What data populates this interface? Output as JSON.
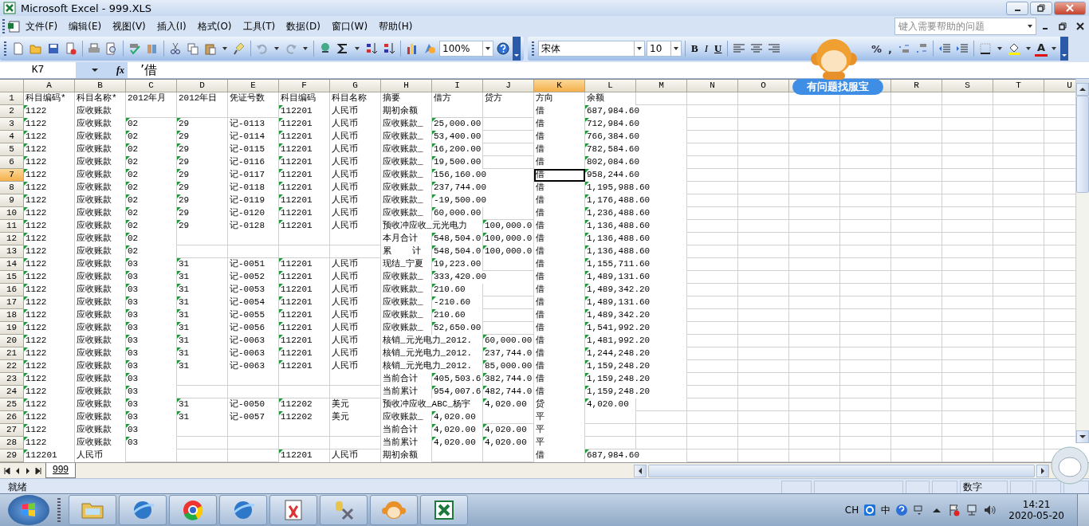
{
  "window": {
    "title": "Microsoft Excel - 999.XLS"
  },
  "menu": [
    "文件(F)",
    "编辑(E)",
    "视图(V)",
    "插入(I)",
    "格式(O)",
    "工具(T)",
    "数据(D)",
    "窗口(W)",
    "帮助(H)"
  ],
  "help_search": {
    "placeholder": "键入需要帮助的问题"
  },
  "standard_toolbar": {
    "zoom": "100%"
  },
  "formatting_toolbar": {
    "font": "宋体",
    "size": "10",
    "bold": "B",
    "italic": "I",
    "underline": "U",
    "percent": "%",
    "comma": ",",
    "font_color": "A"
  },
  "formula_bar": {
    "name_box": "K7",
    "function_label": "fx",
    "formula": "’借"
  },
  "columns": [
    {
      "label": "A",
      "selected": false,
      "text_numbers": true
    },
    {
      "label": "B",
      "selected": false
    },
    {
      "label": "C",
      "selected": false,
      "text_numbers": true
    },
    {
      "label": "D",
      "selected": false,
      "text_numbers": true
    },
    {
      "label": "E",
      "selected": false
    },
    {
      "label": "F",
      "selected": false,
      "text_numbers": true
    },
    {
      "label": "G",
      "selected": false
    },
    {
      "label": "H",
      "selected": false
    },
    {
      "label": "I",
      "selected": false,
      "text_numbers": true
    },
    {
      "label": "J",
      "selected": false,
      "text_numbers": true
    },
    {
      "label": "K",
      "selected": true
    },
    {
      "label": "L",
      "selected": false,
      "text_numbers": true
    },
    {
      "label": "M",
      "selected": false
    },
    {
      "label": "N",
      "selected": false
    },
    {
      "label": "O",
      "selected": false
    },
    {
      "selected": false
    },
    {
      "selected": false
    },
    {
      "label": "R",
      "selected": false
    },
    {
      "label": "S",
      "selected": false
    },
    {
      "label": "T",
      "selected": false
    },
    {
      "label": "U",
      "selected": false
    }
  ],
  "rows": [
    {
      "label": "1",
      "selected": false,
      "cells": [
        "科目编码*",
        "科目名称*",
        "2012年月",
        "2012年日",
        "凭证号数",
        "科目编码",
        "科目名称",
        "摘要",
        "借方",
        "贷方",
        "方向",
        "余额"
      ]
    },
    {
      "label": "2",
      "selected": false,
      "cells": [
        "1122",
        "应收账款",
        "",
        "",
        "",
        "112201",
        "人民币",
        "期初余额",
        "",
        "",
        "借",
        "687,984.60"
      ]
    },
    {
      "label": "3",
      "selected": false,
      "cells": [
        "1122",
        "应收账款",
        "02",
        "29",
        "记-0113",
        "112201",
        "人民币",
        "应收账款_",
        "25,000.00",
        "",
        "借",
        "712,984.60"
      ]
    },
    {
      "label": "4",
      "selected": false,
      "cells": [
        "1122",
        "应收账款",
        "02",
        "29",
        "记-0114",
        "112201",
        "人民币",
        "应收账款_",
        "53,400.00",
        "",
        "借",
        "766,384.60"
      ]
    },
    {
      "label": "5",
      "selected": false,
      "cells": [
        "1122",
        "应收账款",
        "02",
        "29",
        "记-0115",
        "112201",
        "人民币",
        "应收账款_",
        "16,200.00",
        "",
        "借",
        "782,584.60"
      ]
    },
    {
      "label": "6",
      "selected": false,
      "cells": [
        "1122",
        "应收账款",
        "02",
        "29",
        "记-0116",
        "112201",
        "人民币",
        "应收账款_",
        "19,500.00",
        "",
        "借",
        "802,084.60"
      ]
    },
    {
      "label": "7",
      "selected": true,
      "cells": [
        "1122",
        "应收账款",
        "02",
        "29",
        "记-0117",
        "112201",
        "人民币",
        "应收账款_",
        "156,160.00",
        "",
        "借",
        "958,244.60"
      ]
    },
    {
      "label": "8",
      "selected": false,
      "cells": [
        "1122",
        "应收账款",
        "02",
        "29",
        "记-0118",
        "112201",
        "人民币",
        "应收账款_",
        "237,744.00",
        "",
        "借",
        "1,195,988.60"
      ]
    },
    {
      "label": "9",
      "selected": false,
      "cells": [
        "1122",
        "应收账款",
        "02",
        "29",
        "记-0119",
        "112201",
        "人民币",
        "应收账款_",
        "-19,500.00",
        "",
        "借",
        "1,176,488.60"
      ]
    },
    {
      "label": "10",
      "selected": false,
      "cells": [
        "1122",
        "应收账款",
        "02",
        "29",
        "记-0120",
        "112201",
        "人民币",
        "应收账款_",
        "60,000.00",
        "",
        "借",
        "1,236,488.60"
      ]
    },
    {
      "label": "11",
      "selected": false,
      "cells": [
        "1122",
        "应收账款",
        "02",
        "29",
        "记-0128",
        "112201",
        "人民币",
        "预收冲应收_元光电力",
        "",
        "100,000.0",
        "借",
        "1,136,488.60"
      ]
    },
    {
      "label": "12",
      "selected": false,
      "cells": [
        "1122",
        "应收账款",
        "02",
        "",
        "",
        "",
        "",
        "本月合计",
        "548,504.0",
        "100,000.0",
        "借",
        "1,136,488.60"
      ]
    },
    {
      "label": "13",
      "selected": false,
      "cells": [
        "1122",
        "应收账款",
        "02",
        "",
        "",
        "",
        "",
        "累    计",
        "548,504.0",
        "100,000.0",
        "借",
        "1,136,488.60"
      ]
    },
    {
      "label": "14",
      "selected": false,
      "cells": [
        "1122",
        "应收账款",
        "03",
        "31",
        "记-0051",
        "112201",
        "人民币",
        "现结_宁夏",
        "19,223.00",
        "",
        "借",
        "1,155,711.60"
      ]
    },
    {
      "label": "15",
      "selected": false,
      "cells": [
        "1122",
        "应收账款",
        "03",
        "31",
        "记-0052",
        "112201",
        "人民币",
        "应收账款_",
        "333,420.00",
        "",
        "借",
        "1,489,131.60"
      ]
    },
    {
      "label": "16",
      "selected": false,
      "cells": [
        "1122",
        "应收账款",
        "03",
        "31",
        "记-0053",
        "112201",
        "人民币",
        "应收账款_",
        "210.60",
        "",
        "借",
        "1,489,342.20"
      ]
    },
    {
      "label": "17",
      "selected": false,
      "cells": [
        "1122",
        "应收账款",
        "03",
        "31",
        "记-0054",
        "112201",
        "人民币",
        "应收账款_",
        "-210.60",
        "",
        "借",
        "1,489,131.60"
      ]
    },
    {
      "label": "18",
      "selected": false,
      "cells": [
        "1122",
        "应收账款",
        "03",
        "31",
        "记-0055",
        "112201",
        "人民币",
        "应收账款_",
        "210.60",
        "",
        "借",
        "1,489,342.20"
      ]
    },
    {
      "label": "19",
      "selected": false,
      "cells": [
        "1122",
        "应收账款",
        "03",
        "31",
        "记-0056",
        "112201",
        "人民币",
        "应收账款_",
        "52,650.00",
        "",
        "借",
        "1,541,992.20"
      ]
    },
    {
      "label": "20",
      "selected": false,
      "cells": [
        "1122",
        "应收账款",
        "03",
        "31",
        "记-0063",
        "112201",
        "人民币",
        "核销_元光电力_2012.",
        "",
        "60,000.00",
        "借",
        "1,481,992.20"
      ]
    },
    {
      "label": "21",
      "selected": false,
      "cells": [
        "1122",
        "应收账款",
        "03",
        "31",
        "记-0063",
        "112201",
        "人民币",
        "核销_元光电力_2012.",
        "",
        "237,744.0",
        "借",
        "1,244,248.20"
      ]
    },
    {
      "label": "22",
      "selected": false,
      "cells": [
        "1122",
        "应收账款",
        "03",
        "31",
        "记-0063",
        "112201",
        "人民币",
        "核销_元光电力_2012.",
        "",
        "85,000.00",
        "借",
        "1,159,248.20"
      ]
    },
    {
      "label": "23",
      "selected": false,
      "cells": [
        "1122",
        "应收账款",
        "03",
        "",
        "",
        "",
        "",
        "当前合计",
        "405,503.6",
        "382,744.0",
        "借",
        "1,159,248.20"
      ]
    },
    {
      "label": "24",
      "selected": false,
      "cells": [
        "1122",
        "应收账款",
        "03",
        "",
        "",
        "",
        "",
        "当前累计",
        "954,007.6",
        "482,744.0",
        "借",
        "1,159,248.20"
      ]
    },
    {
      "label": "25",
      "selected": false,
      "cells": [
        "1122",
        "应收账款",
        "03",
        "31",
        "记-0050",
        "112202",
        "美元",
        "预收冲应收_ABC_杨宇",
        "",
        "4,020.00",
        "贷",
        "4,020.00"
      ]
    },
    {
      "label": "26",
      "selected": false,
      "cells": [
        "1122",
        "应收账款",
        "03",
        "31",
        "记-0057",
        "112202",
        "美元",
        "应收账款_",
        "4,020.00",
        "",
        "平",
        ""
      ]
    },
    {
      "label": "27",
      "selected": false,
      "cells": [
        "1122",
        "应收账款",
        "03",
        "",
        "",
        "",
        "",
        "当前合计",
        "4,020.00",
        "4,020.00",
        "平",
        ""
      ]
    },
    {
      "label": "28",
      "selected": false,
      "cells": [
        "1122",
        "应收账款",
        "03",
        "",
        "",
        "",
        "",
        "当前累计",
        "4,020.00",
        "4,020.00",
        "平",
        ""
      ]
    },
    {
      "label": "29",
      "selected": false,
      "cells": [
        "112201",
        "人民币",
        "",
        "",
        "",
        "112201",
        "人民币",
        "期初余额",
        "",
        "",
        "借",
        "687,984.60"
      ]
    }
  ],
  "sheet_tabs": [
    {
      "label": "999",
      "selected": true
    }
  ],
  "assistant": {
    "bubble": "有问题找服宝"
  },
  "status_bar": {
    "state": "就绪",
    "indicator": "数字"
  },
  "taskbar": {
    "apps": [
      {
        "kind": "folder"
      },
      {
        "kind": "browser"
      },
      {
        "kind": "chrome"
      },
      {
        "kind": "browser"
      },
      {
        "kind": "notepad"
      },
      {
        "kind": "tools"
      },
      {
        "kind": "monkey"
      },
      {
        "kind": "excel"
      }
    ],
    "tray": {
      "language": "CH",
      "ime": "中",
      "time": "14:21",
      "date": "2020-05-20"
    }
  }
}
